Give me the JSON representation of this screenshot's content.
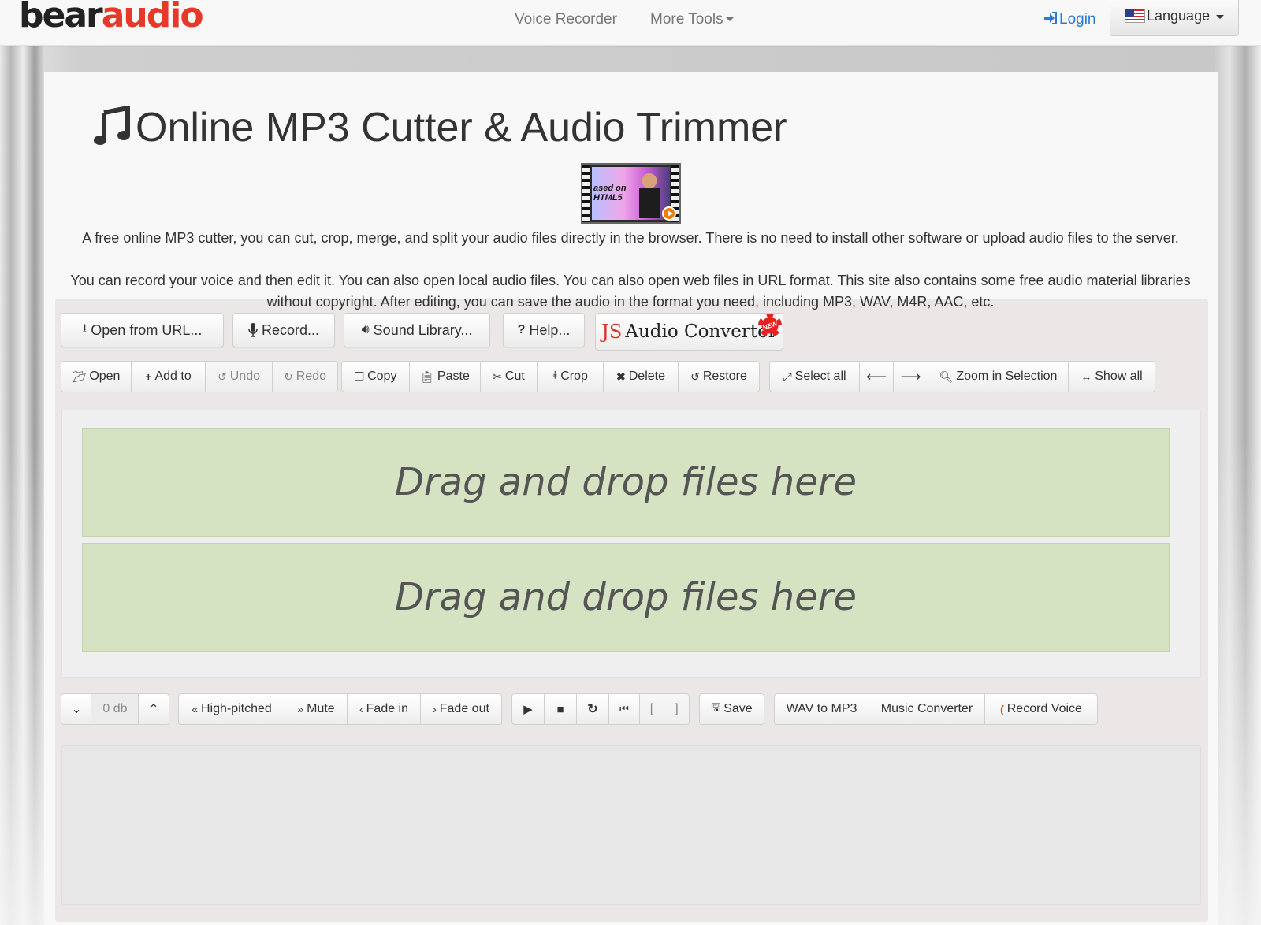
{
  "navbar": {
    "logo_part1": "bear",
    "logo_part2": "audio",
    "voice_recorder": "Voice Recorder",
    "more_tools": "More Tools",
    "login": "Login",
    "language": "Language"
  },
  "page": {
    "title": "Online MP3 Cutter & Audio Trimmer",
    "thumb_text_1": "ased on",
    "thumb_text_2": "HTML5",
    "desc_1": "A free online MP3 cutter, you can cut, crop, merge, and split your audio files directly in the browser. There is no need to install other software or upload audio files to the server.",
    "desc_2": "You can record your voice and then edit it. You can also open local audio files. You can also open web files in URL format. This site also contains some free audio material libraries without copyright. After editing, you can save the audio in the format you need, including MP3, WAV, M4R, AAC, etc."
  },
  "top_buttons": {
    "open_url": "Open from URL...",
    "record": "Record...",
    "sound_library": "Sound Library...",
    "help": "Help...",
    "js_prefix": "JS",
    "js_converter": "Audio Converter",
    "new_badge": "NEW"
  },
  "toolbar": {
    "open": "Open",
    "add_to": "Add to",
    "undo": "Undo",
    "redo": "Redo",
    "copy": "Copy",
    "paste": "Paste",
    "cut": "Cut",
    "crop": "Crop",
    "delete": "Delete",
    "restore": "Restore",
    "select_all": "Select all",
    "zoom_selection": "Zoom in Selection",
    "show_all": "Show all"
  },
  "dropzone": {
    "text_1": "Drag and drop files here",
    "text_2": "Drag and drop files here"
  },
  "controls": {
    "volume": "0 db",
    "high_pitched": "High-pitched",
    "mute": "Mute",
    "fade_in": "Fade in",
    "fade_out": "Fade out",
    "bracket_open": "[",
    "bracket_close": "]",
    "save": "Save",
    "wav_to_mp3": "WAV to MP3",
    "music_converter": "Music Converter",
    "record_voice": "Record Voice"
  },
  "colors": {
    "brand_red": "#e53a2a",
    "link_blue": "#2a7ad6",
    "dropzone_green": "#d6e3c3"
  }
}
